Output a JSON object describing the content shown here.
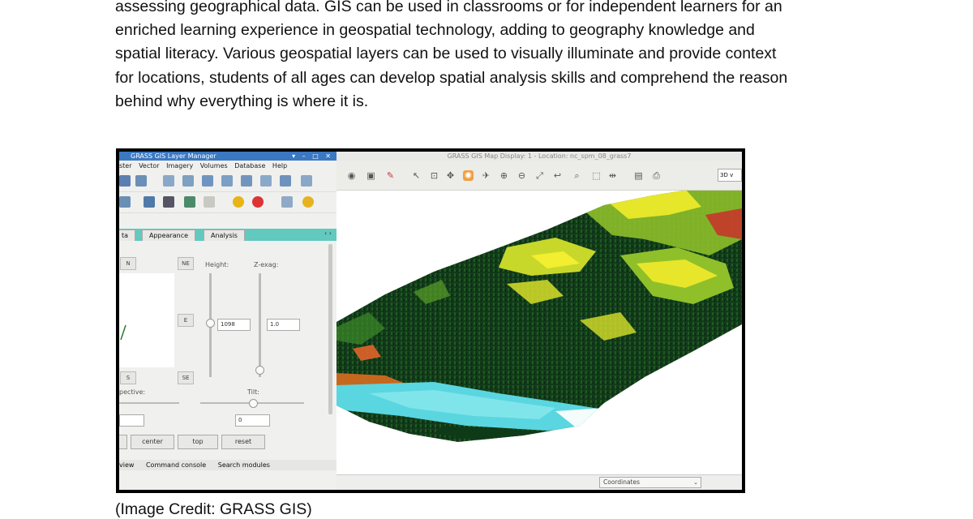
{
  "paragraph": {
    "lines": [
      "assessing geographical data. GIS can be used in classrooms or for independent learners for an",
      "enriched learning experience in geospatial technology, adding to geography knowledge and",
      "spatial literacy. Various geospatial layers can be used to visually illuminate and provide context",
      "for locations, students of all ages can develop spatial analysis skills and comprehend the reason",
      "behind why everything is where it is."
    ]
  },
  "caption": "(Image Credit: GRASS GIS)",
  "layer_manager": {
    "title": "GRASS GIS Layer Manager",
    "window_controls": "▾ – □ ✕",
    "menus": [
      "ster",
      "Vector",
      "Imagery",
      "Volumes",
      "Database",
      "Help"
    ],
    "tabs": [
      "ta",
      "Appearance",
      "Analysis"
    ],
    "direction_buttons": {
      "n": "N",
      "ne": "NE",
      "e": "E",
      "s": "S",
      "se": "SE"
    },
    "height_label": "Height:",
    "zexag_label": "Z-exag:",
    "height_value": "1098",
    "zexag_value": "1.0",
    "perspective_label": "pective:",
    "tilt_label": "Tilt:",
    "tilt_value": "0",
    "buttons": {
      "center": "center",
      "top": "top",
      "reset": "reset"
    },
    "bottom_tabs": [
      "view",
      "Command console",
      "Search modules"
    ]
  },
  "map_display": {
    "title": "GRASS GIS Map Display: 1 - Location: nc_spm_08_grass7",
    "render_mode": "3D v",
    "coordinates_select": "Coordinates"
  },
  "colors": {
    "title_blue": "#3b78c2",
    "tab_teal": "#62c9be",
    "forest_dark": "#0f3a18",
    "meadow_yellow": "#e6e62a",
    "river_cyan": "#5ad6e0"
  }
}
